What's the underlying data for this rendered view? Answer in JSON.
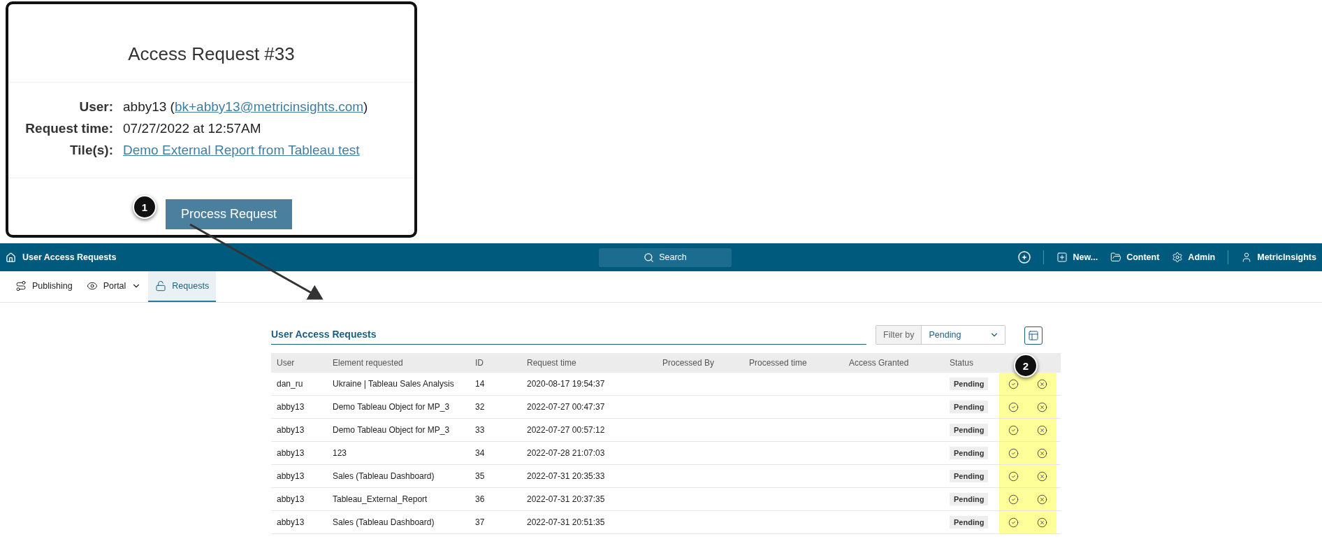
{
  "email_card": {
    "title": "Access Request #33",
    "fields": [
      {
        "label": "User:",
        "kind": "text_link",
        "text_before": "abby13 (",
        "link": "bk+abby13@metricinsights.com",
        "text_after": ")"
      },
      {
        "label": "Request time:",
        "kind": "text",
        "text": "07/27/2022 at 12:57AM"
      },
      {
        "label": "Tile(s):",
        "kind": "link",
        "link": "Demo External Report from Tableau test"
      }
    ],
    "button": "Process Request"
  },
  "annotations": [
    {
      "number": "1"
    },
    {
      "number": "2"
    }
  ],
  "top_bar": {
    "title": "User Access Requests",
    "search": {
      "placeholder": "Search"
    },
    "items": [
      {
        "kind": "new",
        "label": "New..."
      },
      {
        "kind": "content",
        "label": "Content"
      },
      {
        "kind": "admin",
        "label": "Admin"
      },
      {
        "kind": "user",
        "label": "MetricInsights"
      }
    ]
  },
  "tabs": [
    {
      "kind": "publishing",
      "label": "Publishing",
      "selected": false
    },
    {
      "kind": "portal",
      "label": "Portal",
      "selected": false
    },
    {
      "kind": "requests",
      "label": "Requests",
      "selected": true
    }
  ],
  "panel": {
    "title": "User Access Requests",
    "filter": {
      "label": "Filter by",
      "value": "Pending"
    },
    "table": {
      "columns": [
        "User",
        "Element requested",
        "ID",
        "Request time",
        "Processed By",
        "Processed time",
        "Access Granted",
        "Status"
      ],
      "rows": [
        {
          "user": "dan_ru",
          "element": "Ukraine | Tableau Sales Analysis",
          "id": "14",
          "request_time": "2020-08-17 19:54:37",
          "status": "Pending"
        },
        {
          "user": "abby13",
          "element": "Demo Tableau Object for MP_3",
          "id": "32",
          "request_time": "2022-07-27 00:47:37",
          "status": "Pending"
        },
        {
          "user": "abby13",
          "element": "Demo Tableau Object for MP_3",
          "id": "33",
          "request_time": "2022-07-27 00:57:12",
          "status": "Pending"
        },
        {
          "user": "abby13",
          "element": "123",
          "id": "34",
          "request_time": "2022-07-28 21:07:03",
          "status": "Pending"
        },
        {
          "user": "abby13",
          "element": "Sales (Tableau Dashboard)",
          "id": "35",
          "request_time": "2022-07-31 20:35:33",
          "status": "Pending"
        },
        {
          "user": "abby13",
          "element": "Tableau_External_Report",
          "id": "36",
          "request_time": "2022-07-31 20:37:35",
          "status": "Pending"
        },
        {
          "user": "abby13",
          "element": "Sales (Tableau Dashboard)",
          "id": "37",
          "request_time": "2022-07-31 20:51:35",
          "status": "Pending"
        }
      ]
    }
  }
}
